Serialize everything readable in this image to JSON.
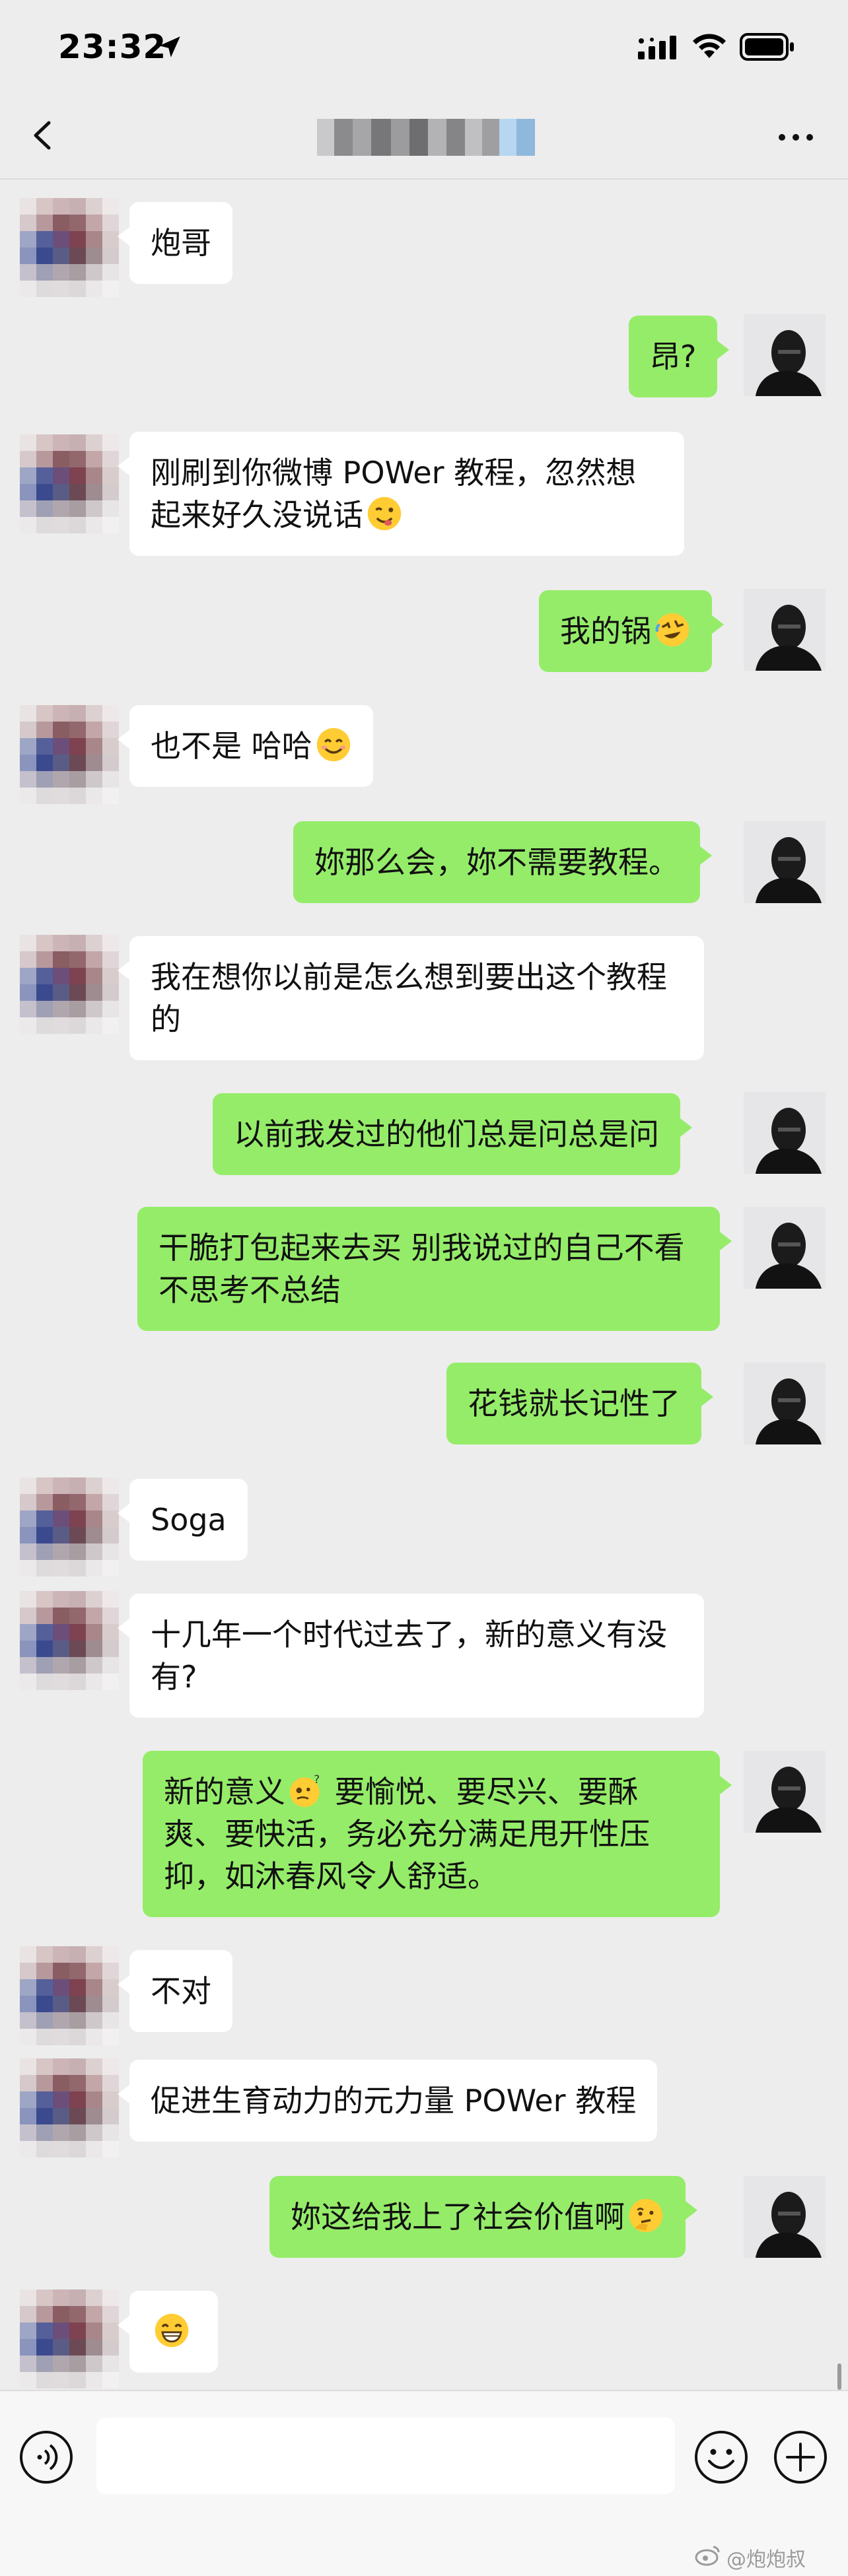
{
  "status_bar": {
    "time": "23:32"
  },
  "nav": {
    "title": ""
  },
  "messages": [
    {
      "side": "in",
      "text": "炮哥",
      "emoji": ""
    },
    {
      "side": "out",
      "text": "昂?",
      "emoji": ""
    },
    {
      "side": "in",
      "text": "刚刷到你微博 POWer 教程，忽然想起来好久没说话",
      "emoji": "wink"
    },
    {
      "side": "out",
      "text": "我的锅",
      "emoji": "rofl"
    },
    {
      "side": "in",
      "text": "也不是 哈哈",
      "emoji": "smile"
    },
    {
      "side": "out",
      "text": "妳那么会，妳不需要教程。",
      "emoji": ""
    },
    {
      "side": "in",
      "text": "我在想你以前是怎么想到要出这个教程的",
      "emoji": ""
    },
    {
      "side": "out",
      "text": "以前我发过的他们总是问总是问",
      "emoji": ""
    },
    {
      "side": "out",
      "text": "干脆打包起来去买 别我说过的自己不看不思考不总结",
      "emoji": ""
    },
    {
      "side": "out",
      "text": "花钱就长记性了",
      "emoji": ""
    },
    {
      "side": "in",
      "text": "Soga",
      "emoji": ""
    },
    {
      "side": "in",
      "text": "十几年一个时代过去了，新的意义有没有?",
      "emoji": ""
    },
    {
      "side": "out",
      "text_before": "新的意义",
      "emoji_inline": "thinking",
      "text": "要愉悦、要尽兴、要酥爽、要快活，务必充分满足甩开性压抑，如沐春风令人舒适。",
      "emoji": ""
    },
    {
      "side": "in",
      "text": "不对",
      "emoji": ""
    },
    {
      "side": "in",
      "text": "促进生育动力的元力量 POWer 教程",
      "emoji": ""
    },
    {
      "side": "out",
      "text": "妳这给我上了社会价值啊",
      "emoji": "thinking2"
    },
    {
      "side": "in",
      "text": "",
      "emoji": "grin"
    }
  ],
  "input_bar": {
    "placeholder": ""
  },
  "watermark": "@炮炮叔",
  "colors": {
    "background": "#ededed",
    "bubble_out": "#95ec69",
    "bubble_in": "#ffffff"
  }
}
